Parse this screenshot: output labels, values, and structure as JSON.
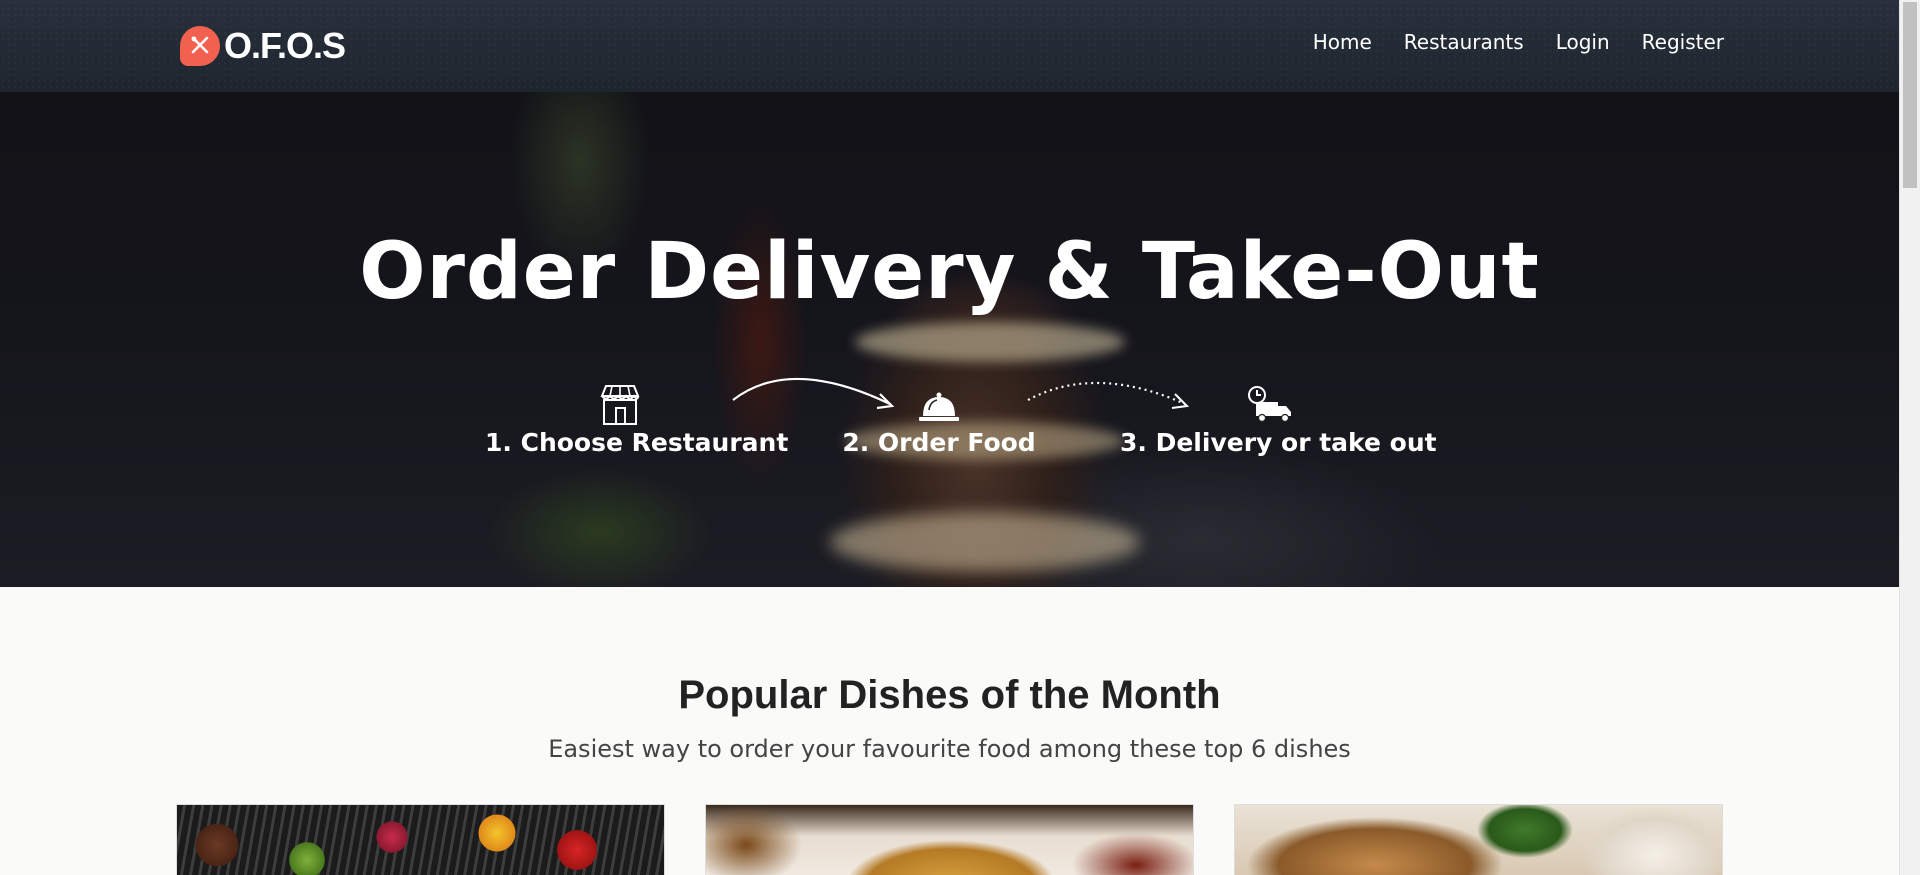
{
  "brand": {
    "name": "O.F.O.S"
  },
  "nav": {
    "items": [
      {
        "label": "Home"
      },
      {
        "label": "Restaurants"
      },
      {
        "label": "Login"
      },
      {
        "label": "Register"
      }
    ]
  },
  "hero": {
    "title": "Order Delivery & Take-Out",
    "steps": [
      {
        "label": "1. Choose Restaurant",
        "icon": "store-icon"
      },
      {
        "label": "2. Order Food",
        "icon": "cloche-icon"
      },
      {
        "label": "3. Delivery or take out",
        "icon": "delivery-truck-icon"
      }
    ]
  },
  "popular": {
    "title": "Popular Dishes of the Month",
    "subtitle": "Easiest way to order your favourite food among these top 6 dishes"
  },
  "colors": {
    "accent": "#f2604f",
    "navbar": "#242c37",
    "page_bg": "#fafaf9"
  }
}
